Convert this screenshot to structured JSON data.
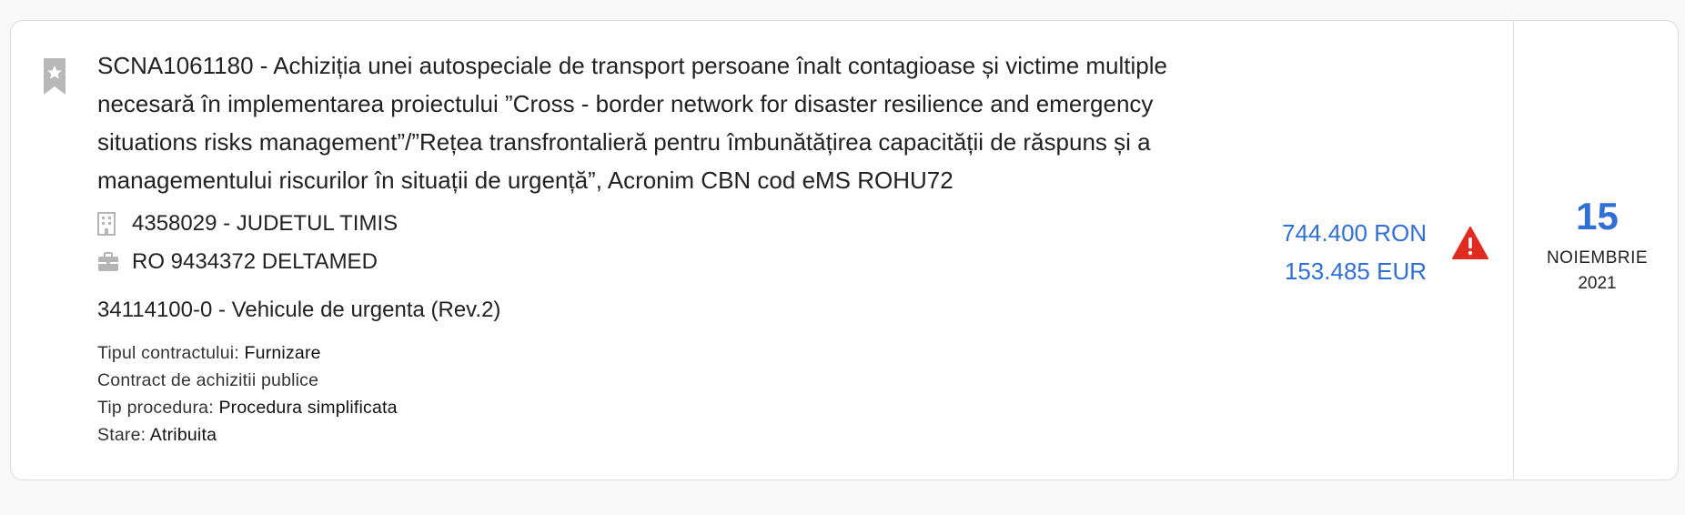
{
  "listing": {
    "title": "SCNA1061180 - Achiziția unei autospeciale de transport persoane înalt contagioase și victime multiple necesară în implementarea proiectului ”Cross - border network for disaster resilience and emergency situations risks management”/”Rețea transfrontalieră pentru îmbunătățirea capacității de răspuns și a managementului riscurilor în situații de urgență”, Acronim CBN cod eMS ROHU72",
    "authority": "4358029 - JUDETUL TIMIS",
    "supplier": "RO 9434372 DELTAMED",
    "cpv": "34114100-0 - Vehicule de urgenta (Rev.2)",
    "details": {
      "contract_type_label": "Tipul contractului:",
      "contract_type_value": "Furnizare",
      "contract_kind": "Contract de achizitii publice",
      "procedure_label": "Tip procedura:",
      "procedure_value": "Procedura simplificata",
      "status_label": "Stare:",
      "status_value": "Atribuita"
    },
    "amount_ron": "744.400 RON",
    "amount_eur": "153.485 EUR",
    "date": {
      "day": "15",
      "month": "NOIEMBRIE",
      "year": "2021"
    }
  },
  "icons": {
    "bookmark": "bookmark-star-icon",
    "authority": "building-icon",
    "supplier": "briefcase-icon",
    "warning": "warning-triangle-icon"
  },
  "colors": {
    "accent": "#2f6fd6",
    "warning": "#e02b20",
    "icon_gray": "#b5b5b5"
  }
}
